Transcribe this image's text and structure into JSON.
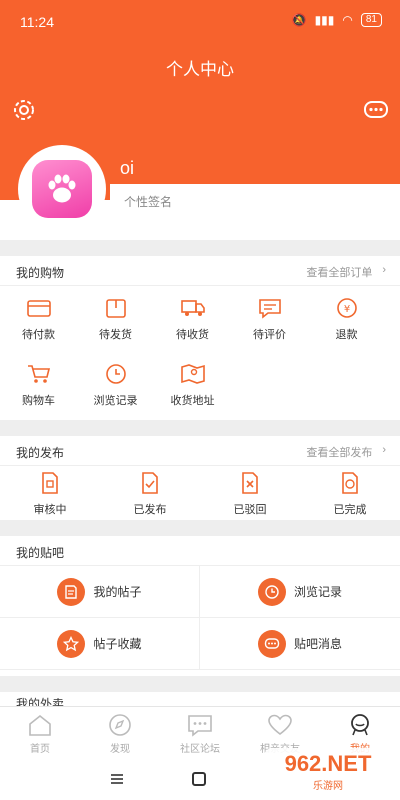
{
  "status": {
    "time": "11:24",
    "battery": "81"
  },
  "header": {
    "title": "个人中心"
  },
  "profile": {
    "username": "oi",
    "signature": "个性签名"
  },
  "shopping": {
    "title": "我的购物",
    "more": "查看全部订单",
    "items": [
      {
        "label": "待付款",
        "icon": "wallet-icon"
      },
      {
        "label": "待发货",
        "icon": "package-icon"
      },
      {
        "label": "待收货",
        "icon": "truck-icon"
      },
      {
        "label": "待评价",
        "icon": "comment-icon"
      },
      {
        "label": "退款",
        "icon": "refund-icon"
      },
      {
        "label": "购物车",
        "icon": "cart-icon"
      },
      {
        "label": "浏览记录",
        "icon": "clock-icon"
      },
      {
        "label": "收货地址",
        "icon": "map-icon"
      }
    ]
  },
  "publish": {
    "title": "我的发布",
    "more": "查看全部发布",
    "items": [
      {
        "label": "审核中",
        "icon": "review-doc-icon"
      },
      {
        "label": "已发布",
        "icon": "published-doc-icon"
      },
      {
        "label": "已驳回",
        "icon": "rejected-doc-icon"
      },
      {
        "label": "已完成",
        "icon": "completed-doc-icon"
      }
    ]
  },
  "tieba": {
    "title": "我的贴吧",
    "items": [
      {
        "label": "我的帖子",
        "icon": "post-icon"
      },
      {
        "label": "浏览记录",
        "icon": "clock-icon"
      },
      {
        "label": "帖子收藏",
        "icon": "star-icon"
      },
      {
        "label": "贴吧消息",
        "icon": "message-icon"
      }
    ]
  },
  "partial_section": {
    "title": "我的外卖"
  },
  "tabs": [
    {
      "label": "首页",
      "icon": "home-icon"
    },
    {
      "label": "发现",
      "icon": "compass-icon"
    },
    {
      "label": "社区论坛",
      "icon": "forum-icon"
    },
    {
      "label": "相亲交友",
      "icon": "heart-icon"
    },
    {
      "label": "我的",
      "icon": "profile-icon"
    }
  ],
  "watermark": {
    "big": "962.NET",
    "small": "乐游网"
  },
  "colors": {
    "accent": "#f7622d"
  }
}
